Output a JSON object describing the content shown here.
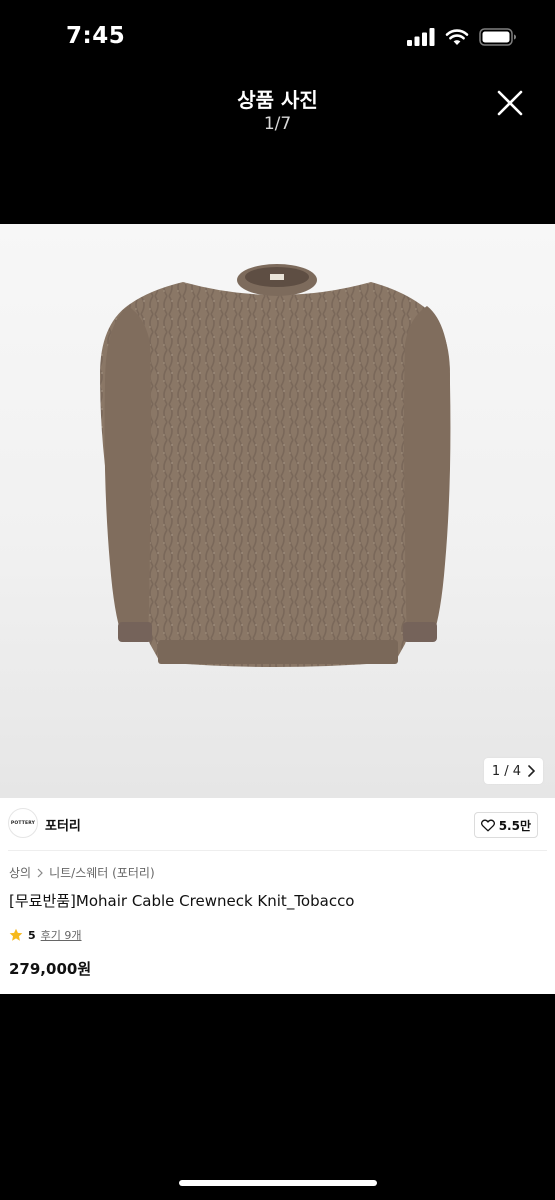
{
  "status_bar": {
    "time": "7:45"
  },
  "viewer": {
    "title": "상품 사진",
    "counter": "1/7"
  },
  "photo": {
    "indicator": "1 / 4"
  },
  "brand": {
    "logo_text": "POTTERY",
    "name": "포터리"
  },
  "like": {
    "count": "5.5만"
  },
  "breadcrumb": {
    "category": "상의",
    "subcategory": "니트/스웨터 (포터리)"
  },
  "product": {
    "title": "[무료반품]Mohair Cable Crewneck Knit_Tobacco",
    "rating": "5",
    "reviews": "후기 9개",
    "price": "279,000원"
  },
  "colors": {
    "sweater": "#8a7766",
    "star": "#f6b91c"
  }
}
